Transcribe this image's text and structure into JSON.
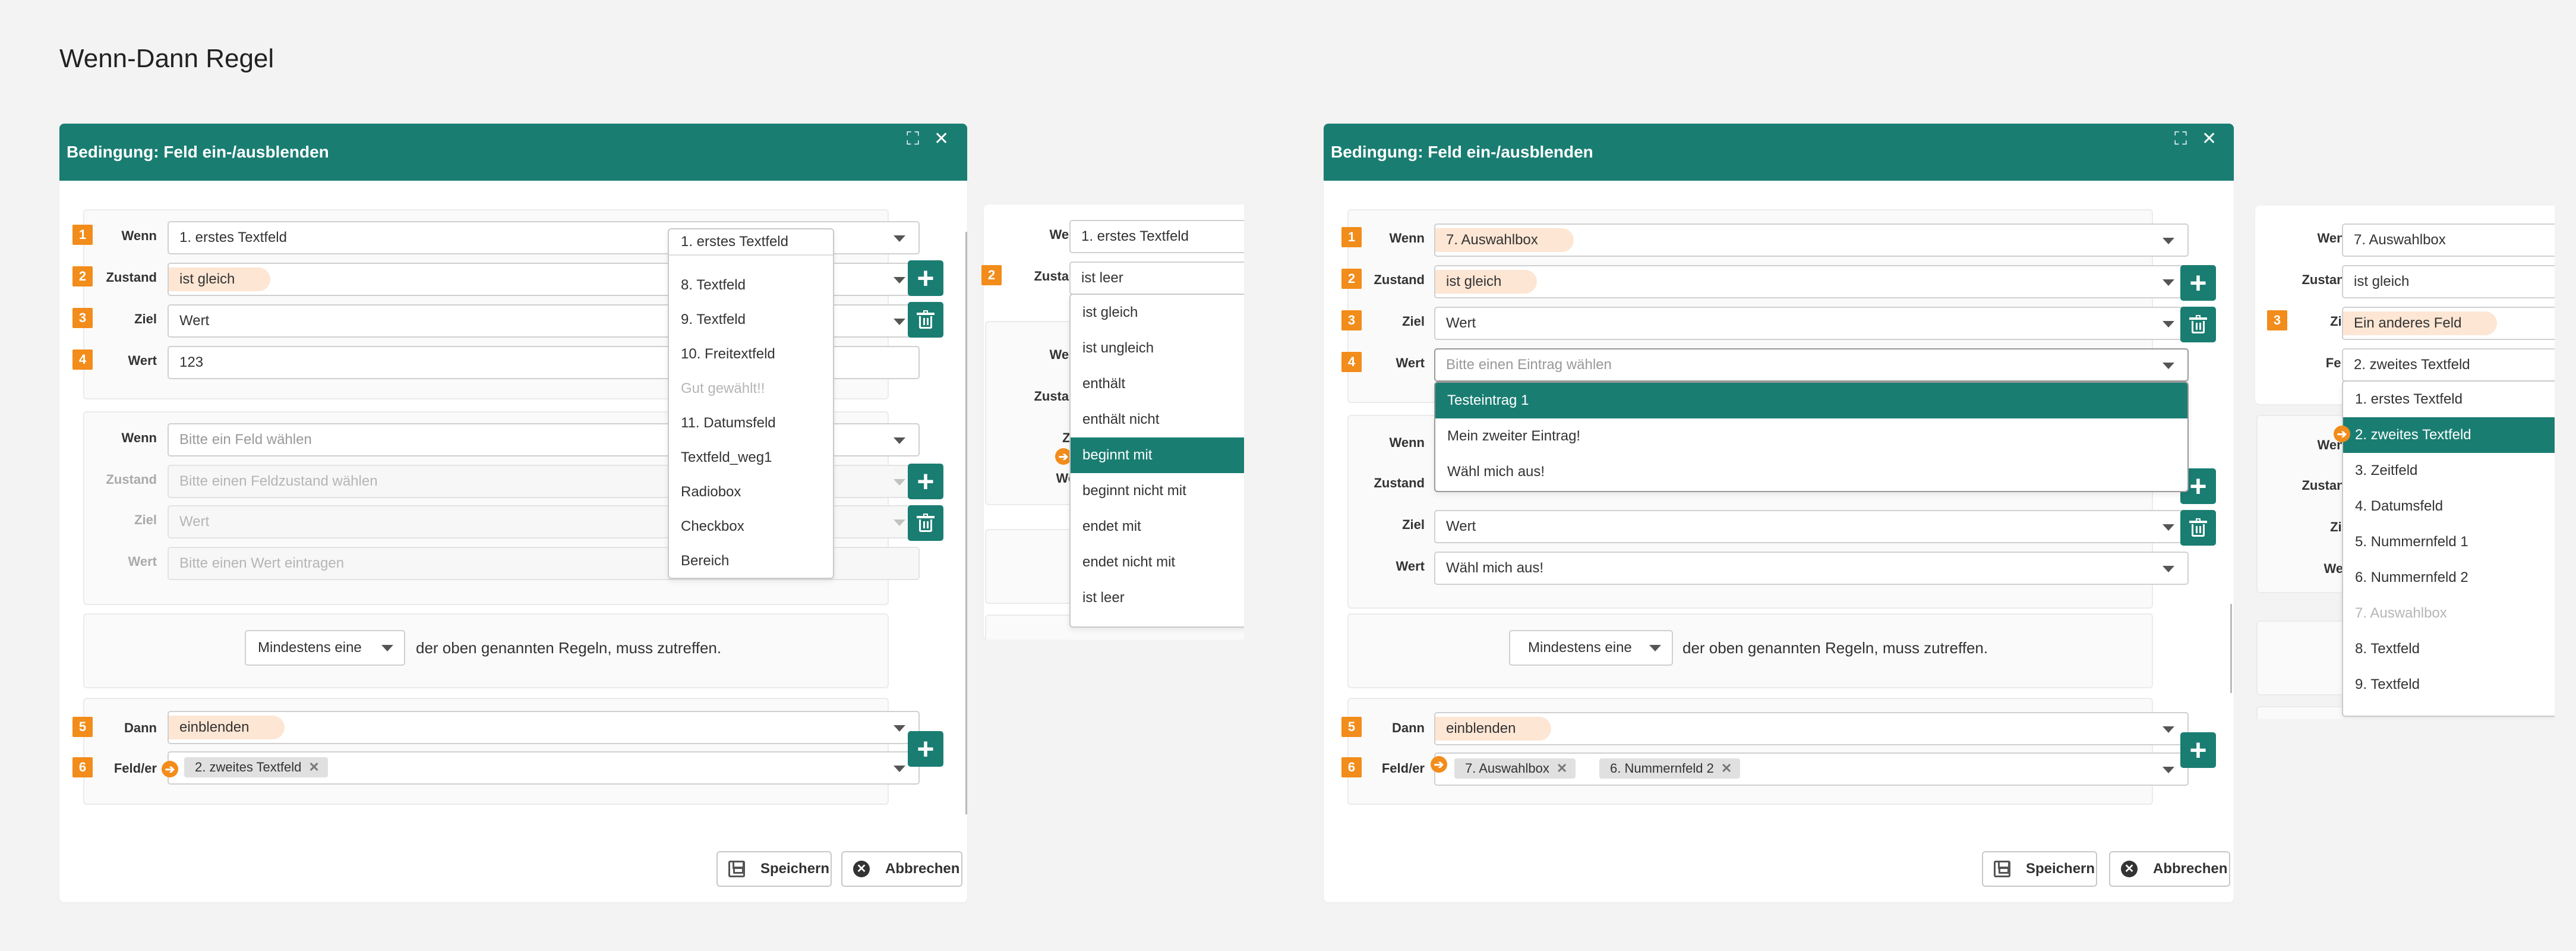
{
  "page_title": "Wenn-Dann Regel",
  "colors": {
    "primary": "#1a7d72",
    "badge": "#f28c1a",
    "highlight": "#fde6d4"
  },
  "icons": {
    "expand": "expand-icon",
    "close": "close-icon",
    "add": "plus-icon",
    "delete": "trash-icon",
    "save": "save-icon",
    "cancel": "cancel-icon",
    "pointer": "arrow-right-icon"
  },
  "labels": {
    "wenn": "Wenn",
    "zustand": "Zustand",
    "ziel": "Ziel",
    "wert": "Wert",
    "feld": "Feld",
    "dann": "Dann",
    "felder": "Feld/er"
  },
  "badges": [
    "1",
    "2",
    "3",
    "4",
    "5",
    "6"
  ],
  "common": {
    "dialog_title": "Bedingung: Feld ein-/ausblenden",
    "mindestens": "Mindestens eine",
    "rule_text": "der oben genannten Regeln, muss zutreffen.",
    "save": "Speichern",
    "cancel": "Abbrechen",
    "einblenden": "einblenden"
  },
  "d1": {
    "c1": {
      "wenn": "1. erstes Textfeld",
      "zustand": "ist gleich",
      "ziel": "Wert",
      "wert": "123"
    },
    "c2": {
      "wenn": "Bitte ein Feld wählen",
      "zustand": "Bitte einen Feldzustand wählen",
      "ziel": "Wert",
      "wert": "Bitte einen Wert eintragen"
    },
    "field_tag": "2. zweites Textfeld",
    "dropdown": {
      "selected": "1. erstes Textfeld",
      "options": [
        "8. Textfeld",
        "9. Textfeld",
        "10. Freitextfeld",
        "Gut gewählt!!",
        "11. Datumsfeld",
        "Textfeld_weg1",
        "Radiobox",
        "Checkbox",
        "Bereich"
      ]
    }
  },
  "p1": {
    "wenn": "1. erstes Textfeld",
    "zustand": "ist leer",
    "options": [
      "ist gleich",
      "ist ungleich",
      "enthält",
      "enthält nicht",
      "beginnt mit",
      "beginnt nicht mit",
      "endet mit",
      "endet nicht mit",
      "ist leer"
    ],
    "selected_index": 4
  },
  "d2": {
    "c1": {
      "wenn": "7. Auswahlbox",
      "zustand": "ist gleich",
      "ziel": "Wert",
      "wert": "Bitte einen Eintrag wählen"
    },
    "options": [
      "Testeintrag 1",
      "Mein zweiter Eintrag!",
      "Wähl mich aus!"
    ],
    "c2": {
      "ziel": "Wert",
      "wert": "Wähl mich aus!"
    },
    "field_tags": [
      "7. Auswahlbox",
      "6. Nummernfeld 2"
    ]
  },
  "p2": {
    "wenn": "7. Auswahlbox",
    "zustand": "ist gleich",
    "ziel": "Ein anderes Feld",
    "feld": "2. zweites Textfeld",
    "options": [
      "1. erstes Textfeld",
      "2. zweites Textfeld",
      "3. Zeitfeld",
      "4. Datumsfeld",
      "5. Nummernfeld 1",
      "6. Nummernfeld 2",
      "7. Auswahlbox",
      "8. Textfeld",
      "9. Textfeld"
    ]
  }
}
